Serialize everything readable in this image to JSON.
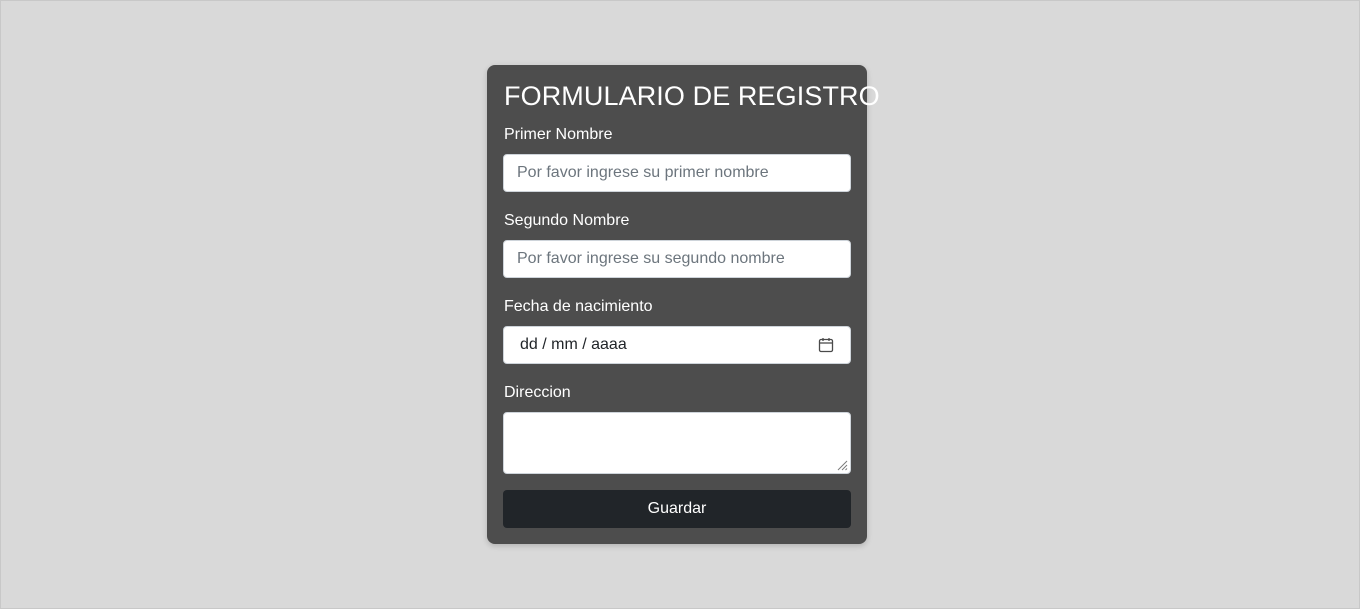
{
  "form": {
    "title": "FORMULARIO DE REGISTRO",
    "first_name": {
      "label": "Primer Nombre",
      "placeholder": "Por favor ingrese su primer nombre",
      "value": ""
    },
    "second_name": {
      "label": "Segundo Nombre",
      "placeholder": "Por favor ingrese su segundo nombre",
      "value": ""
    },
    "birth_date": {
      "label": "Fecha de nacimiento",
      "display": "dd / mm / aaaa",
      "icon": "calendar-icon"
    },
    "address": {
      "label": "Direccion",
      "value": ""
    },
    "submit_label": "Guardar"
  },
  "colors": {
    "page_background": "#d9d9d9",
    "card_background": "#4d4d4d",
    "button_background": "#212529",
    "text_on_dark": "#ffffff"
  }
}
